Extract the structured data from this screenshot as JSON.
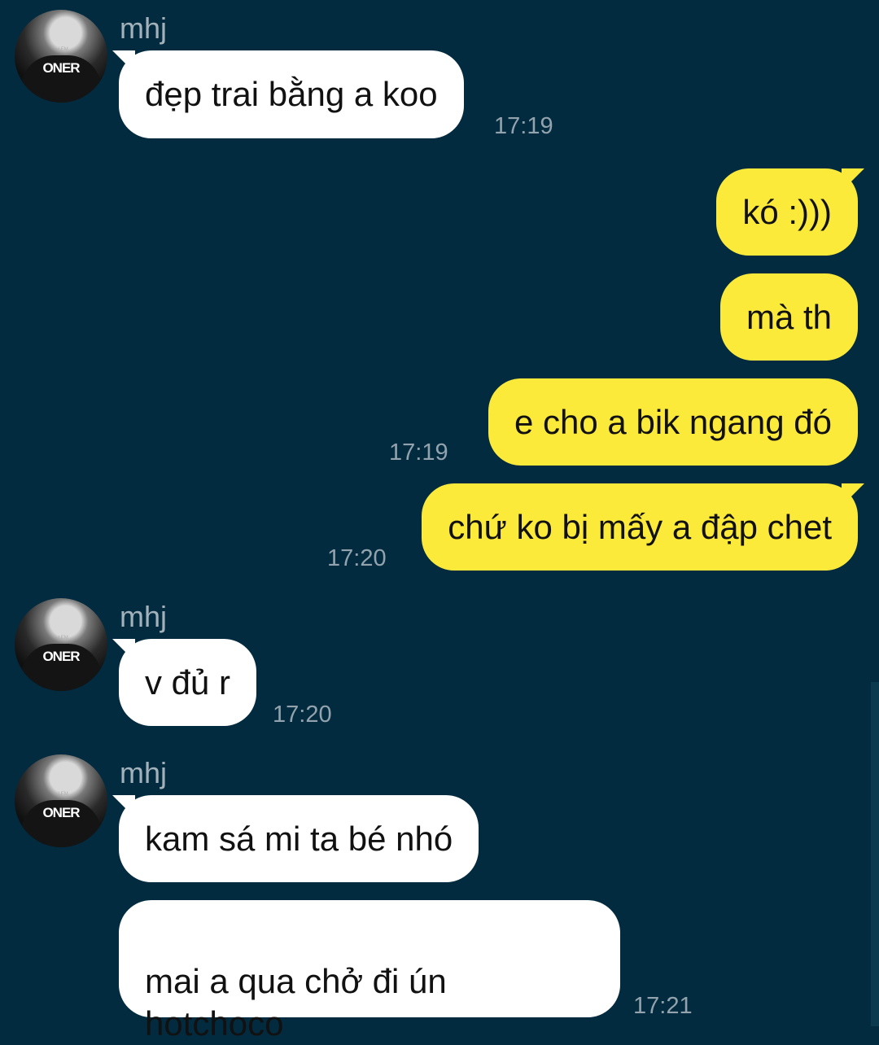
{
  "sender_name": "mhj",
  "avatar_text": "ONER",
  "messages": [
    {
      "text": "đẹp trai bằng a koo",
      "time": "17:19"
    },
    {
      "text": "kó :)))"
    },
    {
      "text": "mà th"
    },
    {
      "text": "e cho a bik ngang đó",
      "time": "17:19"
    },
    {
      "text": "chứ ko bị mấy a đập chet",
      "time": "17:20"
    },
    {
      "text": "v đủ r",
      "time": "17:20"
    },
    {
      "text": "kam sá mi ta bé nhó"
    },
    {
      "text": "mai a qua chở đi ún\nhotchoco",
      "time": "17:21"
    }
  ]
}
